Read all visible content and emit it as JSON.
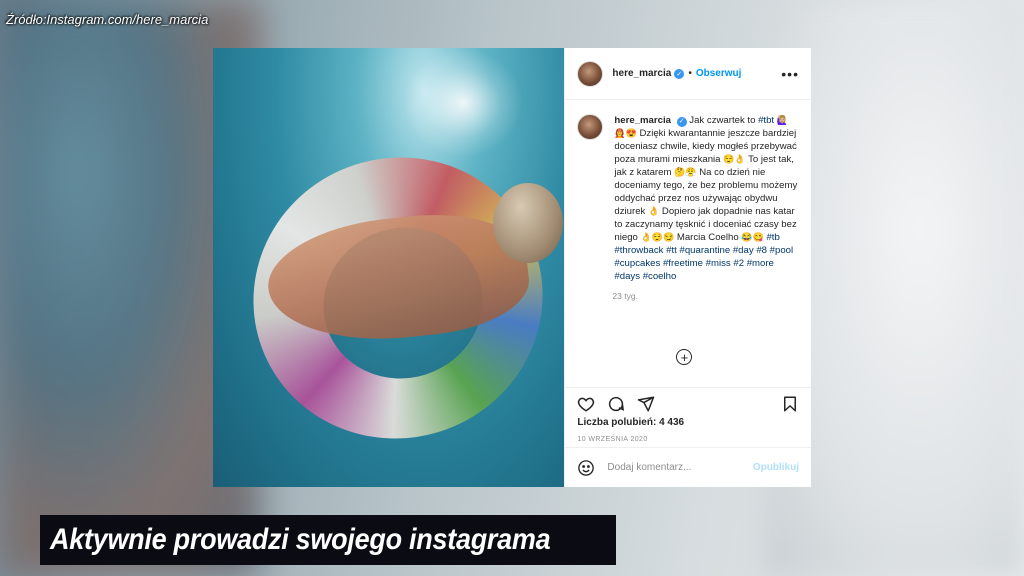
{
  "source": "Źródło:Instagram.com/here_marcia",
  "post": {
    "username": "here_marcia",
    "follow_label": "Obserwuj",
    "separator": "•",
    "more_label": "•••",
    "caption": {
      "username": "here_marcia",
      "text_1": "Jak czwartek to ",
      "tag_tbt": "#tbt",
      "emoji_1": "🙋🏼‍♀️👩‍🚒😍",
      "text_2": " Dzięki kwarantannie jeszcze bardziej doceniasz chwile, kiedy mogłeś przebywać poza murami mieszkania ",
      "emoji_2": "😌👌",
      "text_3": " To jest tak, jak z katarem ",
      "emoji_3": "🤔😤",
      "text_4": " Na co dzień nie doceniamy tego, że bez problemu możemy oddychać przez nos używając obydwu dziurek ",
      "emoji_4": "👌",
      "text_5": " Dopiero jak dopadnie nas katar to zaczynamy tęsknić i doceniać czasy bez niego ",
      "emoji_5": "👌😌😏",
      "text_6": " Marcia Coelho ",
      "emoji_6": "😂😋",
      "hashtags": [
        "#tb",
        "#throwback",
        "#tt",
        "#quarantine",
        "#day",
        "#8",
        "#pool",
        "#cupcakes",
        "#freetime",
        "#miss",
        "#2",
        "#more",
        "#days",
        "#coelho"
      ]
    },
    "ago": "23 tyg.",
    "likes_text": "Liczba polubień: 4 436",
    "date": "10 WRZEŚNIA 2020",
    "comment_placeholder": "Dodaj komentarz...",
    "publish_label": "Opublikuj",
    "add_symbol": "+"
  },
  "subtitle": "Aktywnie prowadzi swojego instagrama",
  "colors": {
    "link": "#0095f6",
    "hashtag": "#00376b",
    "publish_disabled": "#b2dffc",
    "subtitle_bg": "#0b0b14"
  },
  "icons": [
    "verified-icon",
    "heart-icon",
    "comment-icon",
    "share-icon",
    "bookmark-icon",
    "emoji-icon",
    "add-icon"
  ]
}
